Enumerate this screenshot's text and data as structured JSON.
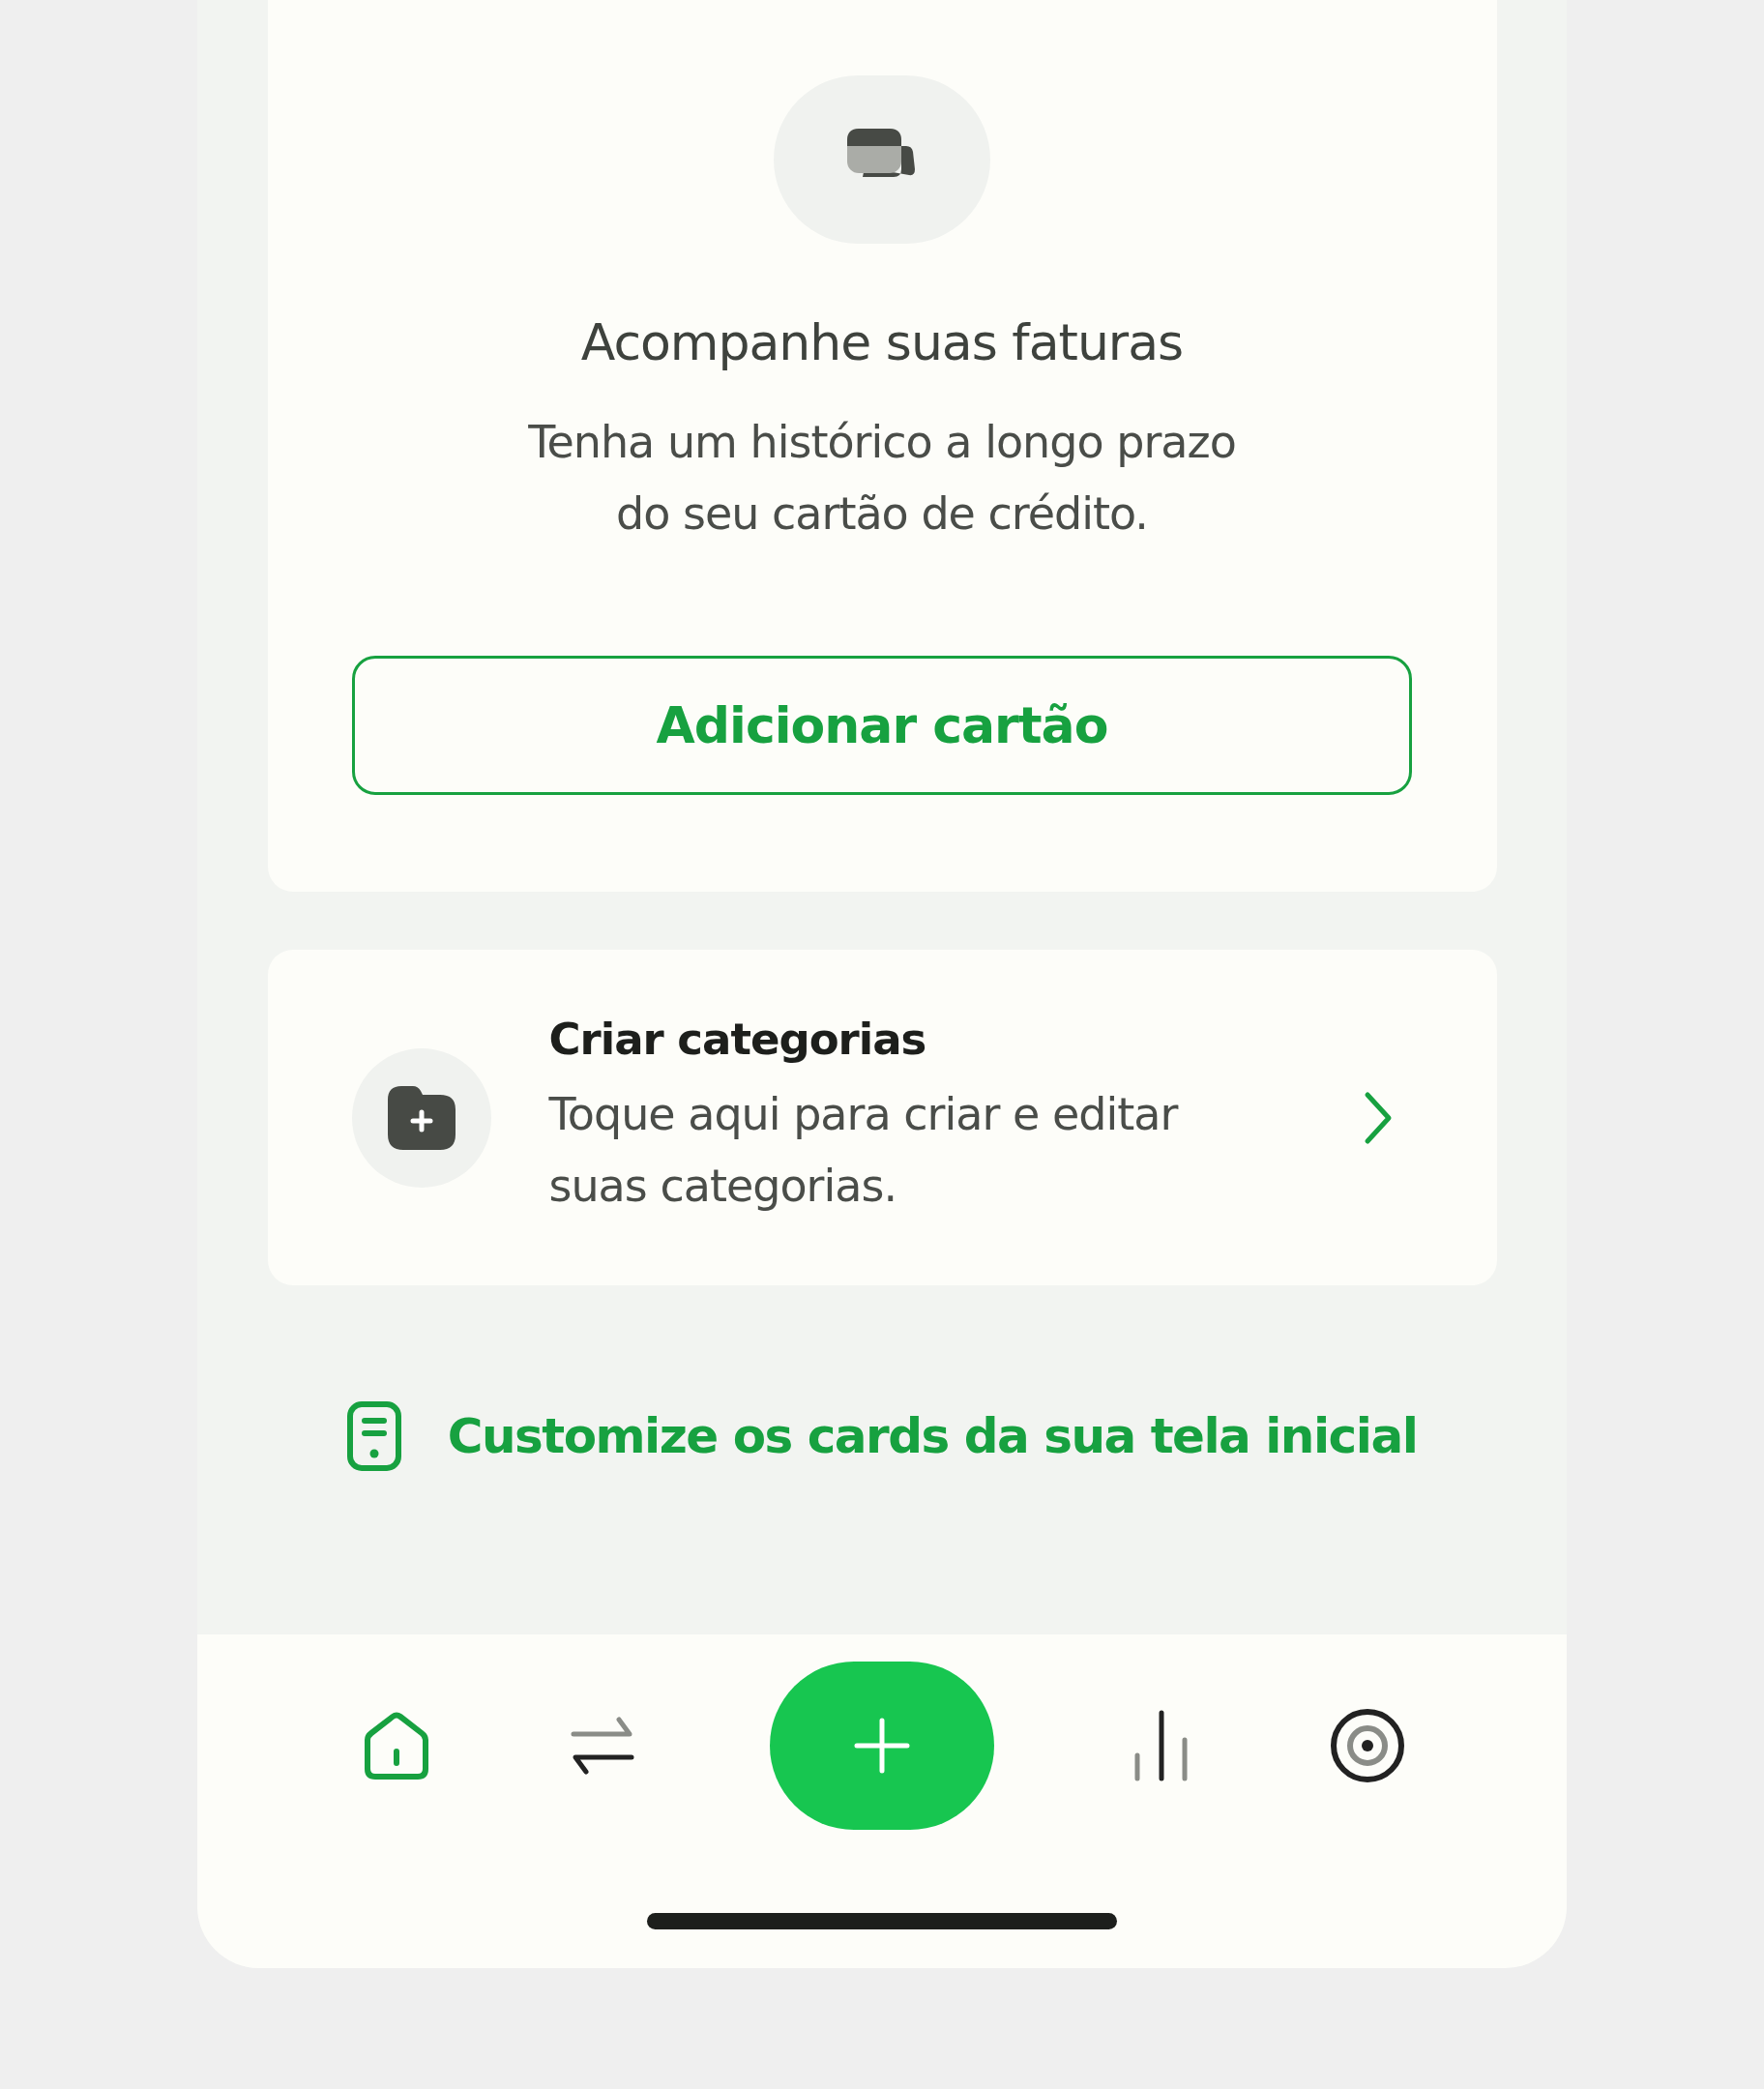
{
  "invoice_card": {
    "title": "Acompanhe suas faturas",
    "description": "Tenha um histórico a longo prazo do seu cartão de crédito.",
    "button": "Adicionar cartão"
  },
  "categories_card": {
    "title": "Criar categorias",
    "description": "Toque aqui para criar e editar suas categorias."
  },
  "customize_link": "Customize os cards da sua tela inicial",
  "bottom_nav": [
    {
      "kind": "home",
      "selected": true
    },
    {
      "kind": "transfer",
      "selected": false
    },
    {
      "kind": "add",
      "selected": false
    },
    {
      "kind": "stats",
      "selected": false
    },
    {
      "kind": "goals",
      "selected": false
    }
  ]
}
